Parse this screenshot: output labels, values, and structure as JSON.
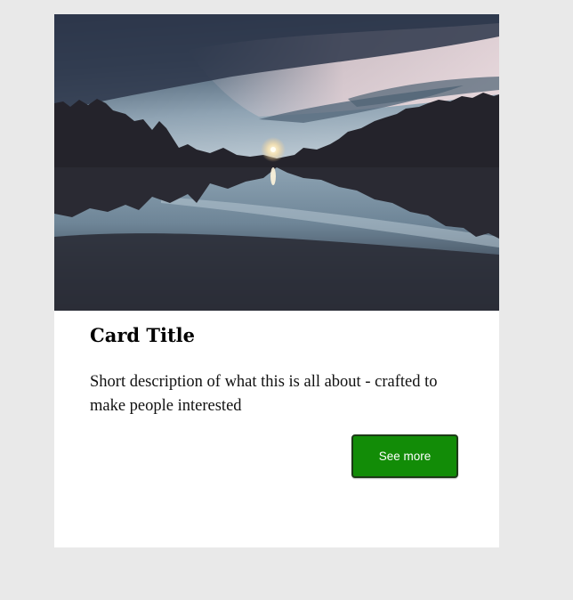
{
  "card": {
    "title": "Card Title",
    "description": "Short description of what this is all about - crafted to make people interested",
    "button_label": "See more",
    "image_subject": "lake-at-dusk-photo"
  },
  "colors": {
    "page_background": "#e9e9e9",
    "card_background": "#ffffff",
    "button_background": "#128c07",
    "button_text": "#ffffff"
  }
}
